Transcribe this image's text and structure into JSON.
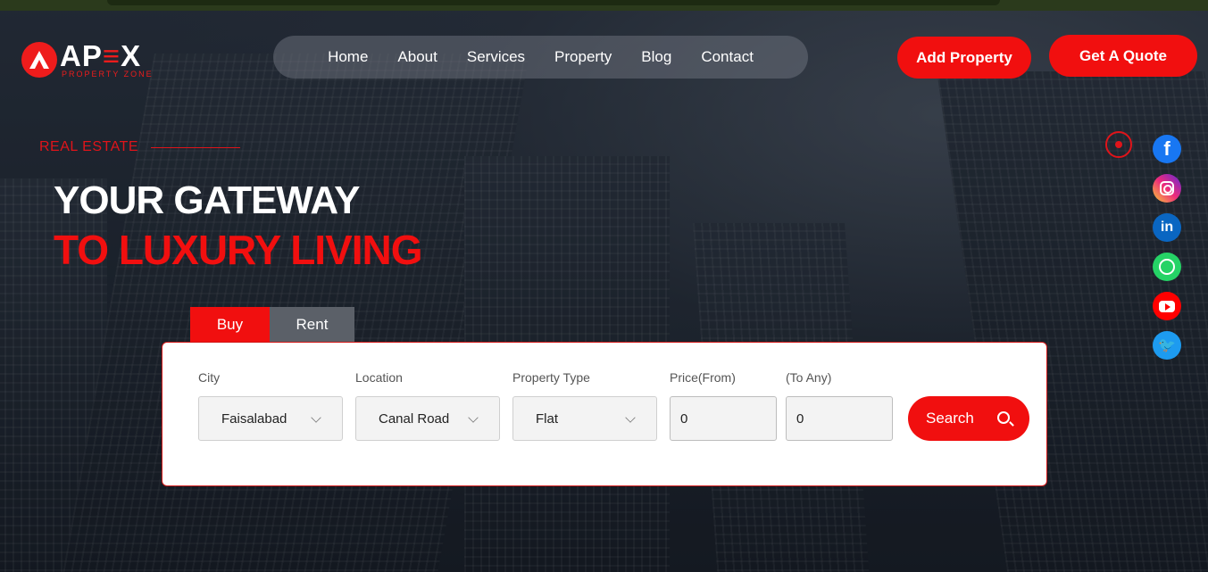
{
  "brand": {
    "name_a": "AP",
    "name_e": "≡",
    "name_b": "X",
    "tagline": "PROPERTY ZONE"
  },
  "nav": {
    "items": [
      "Home",
      "About",
      "Services",
      "Property",
      "Blog",
      "Contact"
    ]
  },
  "header_buttons": {
    "add_property": "Add Property",
    "get_quote": "Get A Quote"
  },
  "hero": {
    "kicker": "REAL ESTATE",
    "title_line1": "YOUR GATEWAY",
    "title_line2": "TO LUXURY LIVING"
  },
  "social": [
    "facebook-icon",
    "instagram-icon",
    "linkedin-icon",
    "whatsapp-icon",
    "youtube-icon",
    "twitter-icon"
  ],
  "tabs": {
    "buy": "Buy",
    "rent": "Rent",
    "active": "Buy"
  },
  "search": {
    "city_label": "City",
    "city_value": "Faisalabad",
    "location_label": "Location",
    "location_value": "Canal Road",
    "type_label": "Property Type",
    "type_value": "Flat",
    "price_from_label": "Price(From)",
    "price_from_value": "0",
    "price_to_label": "(To Any)",
    "price_to_value": "0",
    "button": "Search"
  },
  "colors": {
    "accent": "#f10f0f",
    "nav_bg": "#787d87"
  }
}
